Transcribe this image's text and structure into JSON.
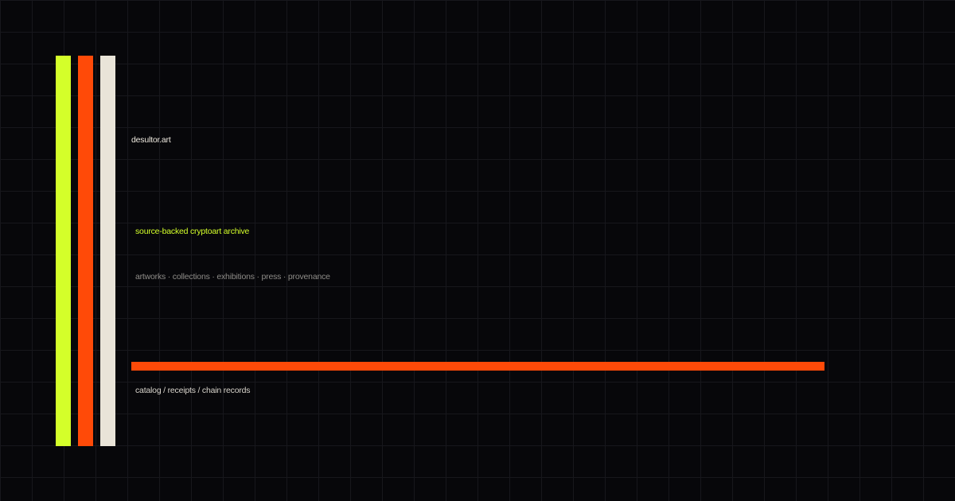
{
  "colors": {
    "background": "#07070a",
    "grid": "#17171c",
    "lime": "#d4ff2a",
    "orange": "#ff4a08",
    "cream": "#e9e4d8"
  },
  "stripes": [
    "#d4ff2a",
    "#ff4a08",
    "#e9e4d8"
  ],
  "site_name": "desultor.art",
  "tagline": "source-backed cryptoart archive",
  "nav_text": "artworks · collections · exhibitions · press · provenance",
  "footer_text": "catalog / receipts / chain records"
}
